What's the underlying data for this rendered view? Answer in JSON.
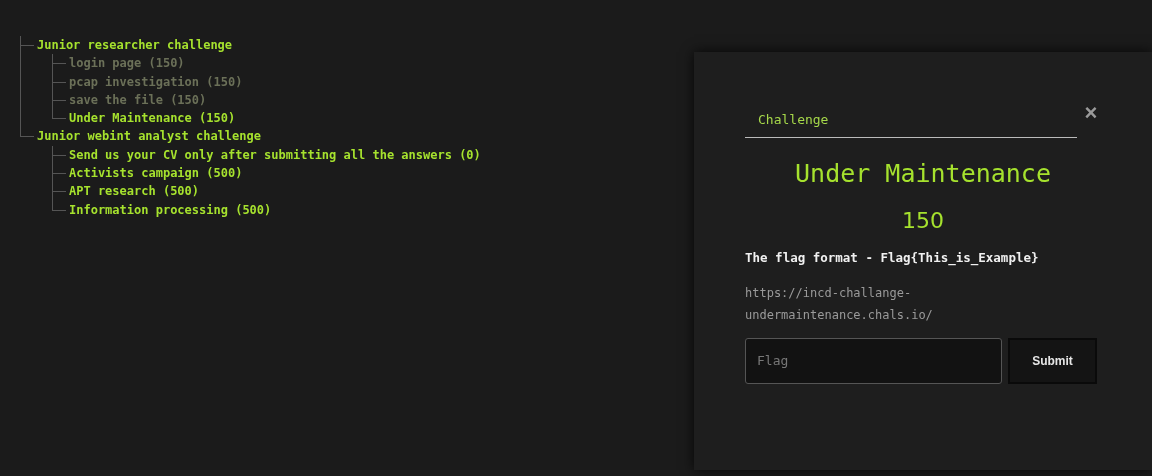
{
  "tree": [
    {
      "label": "Junior researcher challenge",
      "solved": false,
      "children": [
        {
          "label": "login page (150)",
          "solved": true
        },
        {
          "label": "pcap investigation (150)",
          "solved": true
        },
        {
          "label": "save the file (150)",
          "solved": true
        },
        {
          "label": "Under Maintenance (150)",
          "solved": false
        }
      ]
    },
    {
      "label": "Junior webint analyst challenge",
      "solved": false,
      "children": [
        {
          "label": "Send us your CV only after submitting all the answers (0)",
          "solved": false
        },
        {
          "label": "Activists campaign (500)",
          "solved": false
        },
        {
          "label": "APT research (500)",
          "solved": false
        },
        {
          "label": "Information processing (500)",
          "solved": false
        }
      ]
    }
  ],
  "modal": {
    "tab": "Challenge",
    "close": "×",
    "title": "Under Maintenance",
    "points": "150",
    "flag_format": "The flag format - Flag{This_is_Example}",
    "link": "https://incd-challange-undermaintenance.chals.io/",
    "flag_field": {
      "placeholder": "Flag"
    },
    "submit": "Submit"
  }
}
